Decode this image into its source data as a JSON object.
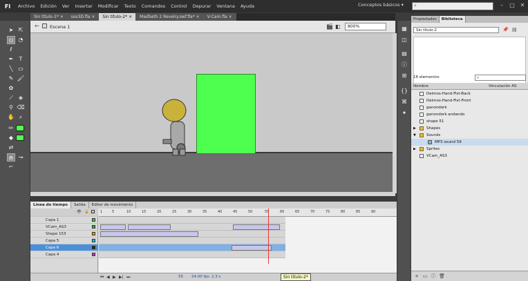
{
  "app": {
    "logo": "Fl"
  },
  "menu": [
    "Archivo",
    "Edición",
    "Ver",
    "Insertar",
    "Modificar",
    "Texto",
    "Comandos",
    "Control",
    "Depurar",
    "Ventana",
    "Ayuda"
  ],
  "workspace": "Conceptos básicos ▾",
  "window_controls": [
    "–",
    "□",
    "✕"
  ],
  "doc_tabs": [
    {
      "label": "Sin título-1* ×",
      "active": false
    },
    {
      "label": "sos3D.fla ×",
      "active": false
    },
    {
      "label": "Sin título-2* ×",
      "active": true
    },
    {
      "label": "MadSeth 2 Revelry.swf.fla* ×",
      "active": false
    },
    {
      "label": "V-Cam.fla ×",
      "active": false
    }
  ],
  "editbar": {
    "scene": "Escena 1",
    "zoom": "800%"
  },
  "colors": {
    "stage_green": "#4fff4f",
    "tween": "#c7c7ec",
    "selection": "#4a90d9"
  },
  "timeline": {
    "tabs": [
      "Línea de tiempo",
      "Salida",
      "Editor de movimiento"
    ],
    "ruler": [
      "1",
      "5",
      "10",
      "15",
      "20",
      "25",
      "30",
      "35",
      "40",
      "45",
      "50",
      "55",
      "60",
      "65",
      "70",
      "75",
      "80",
      "85",
      "90"
    ],
    "layers": [
      {
        "name": "Capa 1",
        "color": "#33cc33",
        "selected": false
      },
      {
        "name": "VCam_AS3",
        "color": "#33aa33",
        "selected": false
      },
      {
        "name": "Shape 153",
        "color": "#e69b00",
        "selected": false
      },
      {
        "name": "Capa 5",
        "color": "#00cccc",
        "selected": false
      },
      {
        "name": "Capa 6",
        "color": "#222222",
        "selected": true
      },
      {
        "name": "Capa 4",
        "color": "#cc33cc",
        "selected": false
      }
    ],
    "status": {
      "frame": "55",
      "fps": "24.00 fps",
      "time": "2.3 s"
    },
    "tooltip": "Sin título-2*"
  },
  "panel": {
    "tabs": [
      "Propiedades",
      "Biblioteca"
    ],
    "doc": "Sin título-2",
    "count": "18 elementos",
    "col_name": "Nombre",
    "col_link": "Vinculación AS",
    "items": [
      {
        "label": "Deimos-Hand-Fist-Back",
        "kind": "symbol",
        "indent": 1
      },
      {
        "label": "Deimos-Hand-Fist-Front",
        "kind": "symbol",
        "indent": 1
      },
      {
        "label": "ganondork",
        "kind": "symbol",
        "indent": 1
      },
      {
        "label": "ganondork andando",
        "kind": "symbol",
        "indent": 1
      },
      {
        "label": "shape 51",
        "kind": "symbol",
        "indent": 1
      },
      {
        "label": "Shapes",
        "kind": "folder",
        "indent": 0
      },
      {
        "label": "Sounds",
        "kind": "folder",
        "indent": 0
      },
      {
        "label": "MP3 sound 59",
        "kind": "sound",
        "indent": 2
      },
      {
        "label": "Sprites",
        "kind": "folder",
        "indent": 0
      },
      {
        "label": "VCam_AS3",
        "kind": "symbol",
        "indent": 1
      }
    ]
  }
}
